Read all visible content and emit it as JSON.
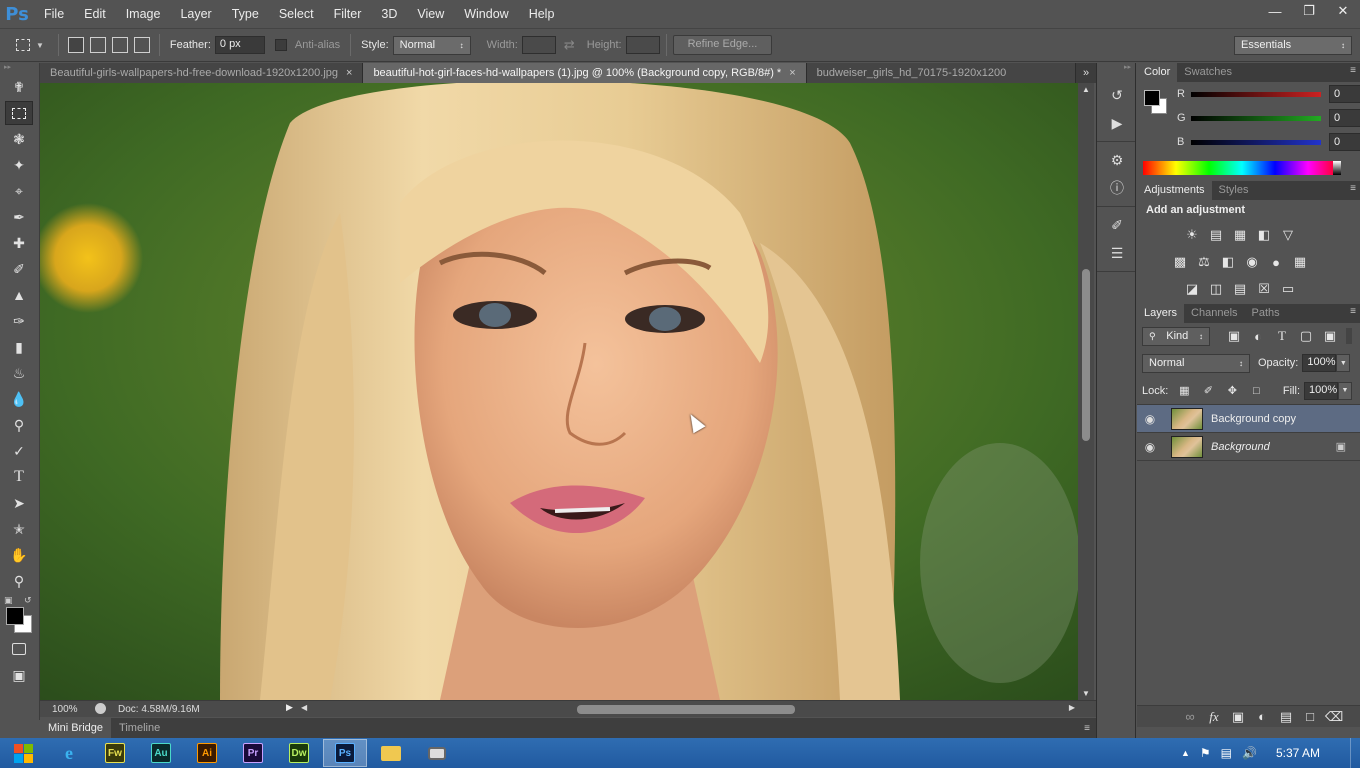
{
  "app": {
    "logo": "Ps",
    "menus": [
      "File",
      "Edit",
      "Image",
      "Layer",
      "Type",
      "Select",
      "Filter",
      "3D",
      "View",
      "Window",
      "Help"
    ],
    "window_controls": [
      "minimize-icon",
      "restore-icon",
      "close-icon"
    ]
  },
  "options": {
    "feather_label": "Feather:",
    "feather_value": "0 px",
    "antialias_label": "Anti-alias",
    "style_label": "Style:",
    "style_value": "Normal",
    "width_label": "Width:",
    "height_label": "Height:",
    "refine_edge": "Refine Edge...",
    "workspace": "Essentials"
  },
  "tabs": [
    {
      "label": "Beautiful-girls-wallpapers-hd-free-download-1920x1200.jpg",
      "active": false
    },
    {
      "label": "beautiful-hot-girl-faces-hd-wallpapers (1).jpg @ 100% (Background copy, RGB/8#) *",
      "active": true
    },
    {
      "label": "budweiser_girls_hd_70175-1920x1200",
      "active": false
    }
  ],
  "tabs_overflow": "»",
  "status": {
    "zoom": "100%",
    "doc": "Doc: 4.58M/9.16M"
  },
  "bottom_tabs": [
    "Mini Bridge",
    "Timeline"
  ],
  "color_panel": {
    "tabs": [
      "Color",
      "Swatches"
    ],
    "channels": [
      {
        "label": "R",
        "value": "0",
        "color": "#cc2222"
      },
      {
        "label": "G",
        "value": "0",
        "color": "#22aa22"
      },
      {
        "label": "B",
        "value": "0",
        "color": "#2233cc"
      }
    ],
    "foreground": "#000000",
    "background": "#ffffff"
  },
  "adjustments_panel": {
    "tabs": [
      "Adjustments",
      "Styles"
    ],
    "heading": "Add an adjustment",
    "row1": [
      "brightness-icon",
      "levels-icon",
      "curves-icon",
      "exposure-icon",
      "vibrance-icon"
    ],
    "row2": [
      "hue-saturation-icon",
      "color-balance-icon",
      "black-white-icon",
      "photo-filter-icon",
      "channel-mixer-icon",
      "color-lookup-icon"
    ],
    "row3": [
      "invert-icon",
      "posterize-icon",
      "threshold-icon",
      "selective-color-icon",
      "gradient-map-icon"
    ]
  },
  "layers_panel": {
    "tabs": [
      "Layers",
      "Channels",
      "Paths"
    ],
    "filter_kind": "Kind",
    "blend_mode": "Normal",
    "opacity_label": "Opacity:",
    "opacity_value": "100%",
    "lock_label": "Lock:",
    "fill_label": "Fill:",
    "fill_value": "100%",
    "layers": [
      {
        "name": "Background copy",
        "selected": true,
        "locked": false
      },
      {
        "name": "Background",
        "selected": false,
        "locked": true
      }
    ]
  },
  "taskbar": {
    "apps": [
      {
        "name": "windows-start",
        "label": ""
      },
      {
        "name": "internet-explorer",
        "label": "e"
      },
      {
        "name": "fireworks",
        "label": "Fw"
      },
      {
        "name": "audition",
        "label": "Au"
      },
      {
        "name": "illustrator",
        "label": "Ai"
      },
      {
        "name": "premiere",
        "label": "Pr"
      },
      {
        "name": "dreamweaver",
        "label": "Dw"
      },
      {
        "name": "photoshop",
        "label": "Ps"
      },
      {
        "name": "file-explorer",
        "label": ""
      },
      {
        "name": "camera-app",
        "label": ""
      }
    ],
    "time": "5:37 AM"
  }
}
